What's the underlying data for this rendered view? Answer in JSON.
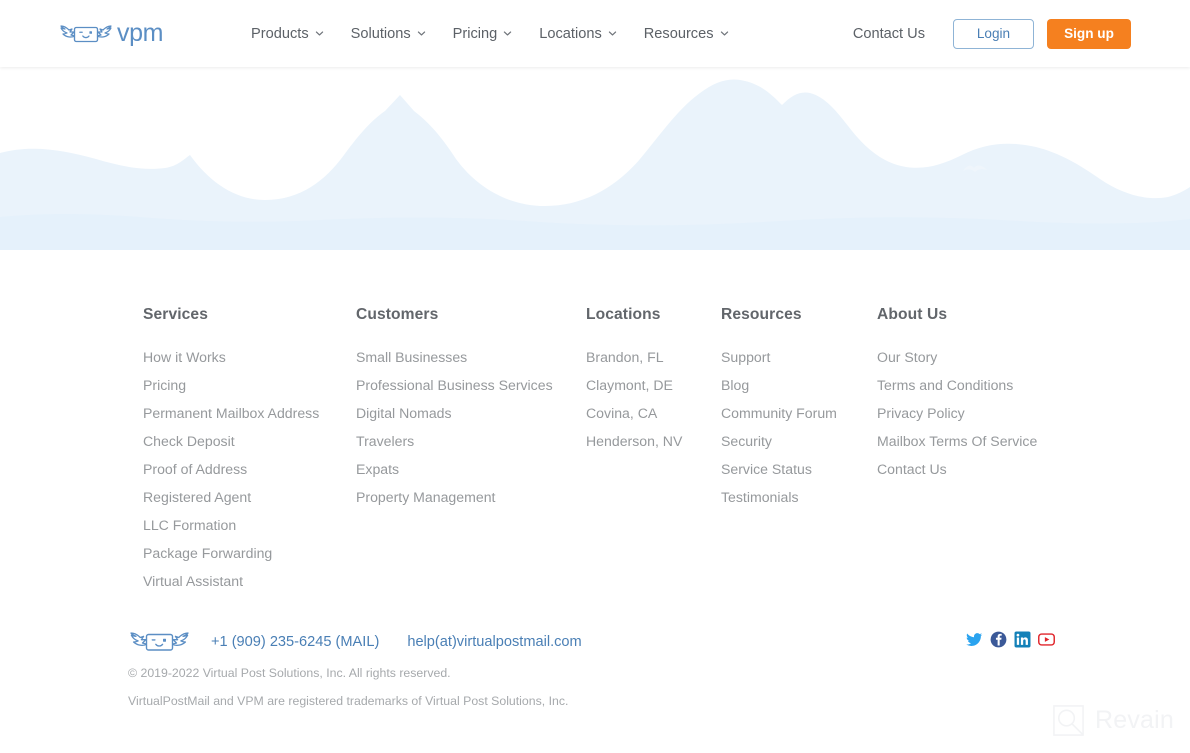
{
  "brand": {
    "logo_text": "vpm",
    "accent_blue": "#4a7fb5",
    "logo_blue": "#5b8ec4",
    "accent_orange": "#f5801f",
    "wave_blue": "#eaf3fb",
    "mark_icon": "winged-envelope-icon"
  },
  "header": {
    "nav": [
      {
        "label": "Products",
        "has_caret": true
      },
      {
        "label": "Solutions",
        "has_caret": true
      },
      {
        "label": "Pricing",
        "has_caret": true
      },
      {
        "label": "Locations",
        "has_caret": true
      },
      {
        "label": "Resources",
        "has_caret": true
      }
    ],
    "contact_label": "Contact Us",
    "login_label": "Login",
    "signup_label": "Sign up"
  },
  "footer": {
    "columns": [
      {
        "title": "Services",
        "links": [
          "How it Works",
          "Pricing",
          "Permanent Mailbox Address",
          "Check Deposit",
          "Proof of Address",
          "Registered Agent",
          "LLC Formation",
          "Package Forwarding",
          "Virtual Assistant"
        ]
      },
      {
        "title": "Customers",
        "links": [
          "Small Businesses",
          "Professional Business Services",
          "Digital Nomads",
          "Travelers",
          "Expats",
          "Property Management"
        ]
      },
      {
        "title": "Locations",
        "links": [
          "Brandon, FL",
          "Claymont, DE",
          "Covina, CA",
          "Henderson, NV"
        ]
      },
      {
        "title": "Resources",
        "links": [
          "Support",
          "Blog",
          "Community Forum",
          "Security",
          "Service Status",
          "Testimonials"
        ]
      },
      {
        "title": "About Us",
        "links": [
          "Our Story",
          "Terms and Conditions",
          "Privacy Policy",
          "Mailbox Terms Of Service",
          "Contact Us"
        ]
      }
    ],
    "phone": "+1 (909) 235-6245 (MAIL)",
    "email": "help(at)virtualpostmail.com",
    "copyright": "© 2019-2022 Virtual Post Solutions, Inc. All rights reserved.",
    "trademark": "VirtualPostMail and VPM are registered trademarks of Virtual Post Solutions, Inc.",
    "socials": [
      {
        "name": "twitter-icon",
        "color": "#2aa3ef"
      },
      {
        "name": "facebook-icon",
        "color": "#3b5998"
      },
      {
        "name": "linkedin-icon",
        "color": "#0e76a8"
      },
      {
        "name": "youtube-icon",
        "color": "#e0242a"
      }
    ]
  },
  "watermark": {
    "text": "Revain",
    "icon": "revain-magnifier-icon"
  }
}
